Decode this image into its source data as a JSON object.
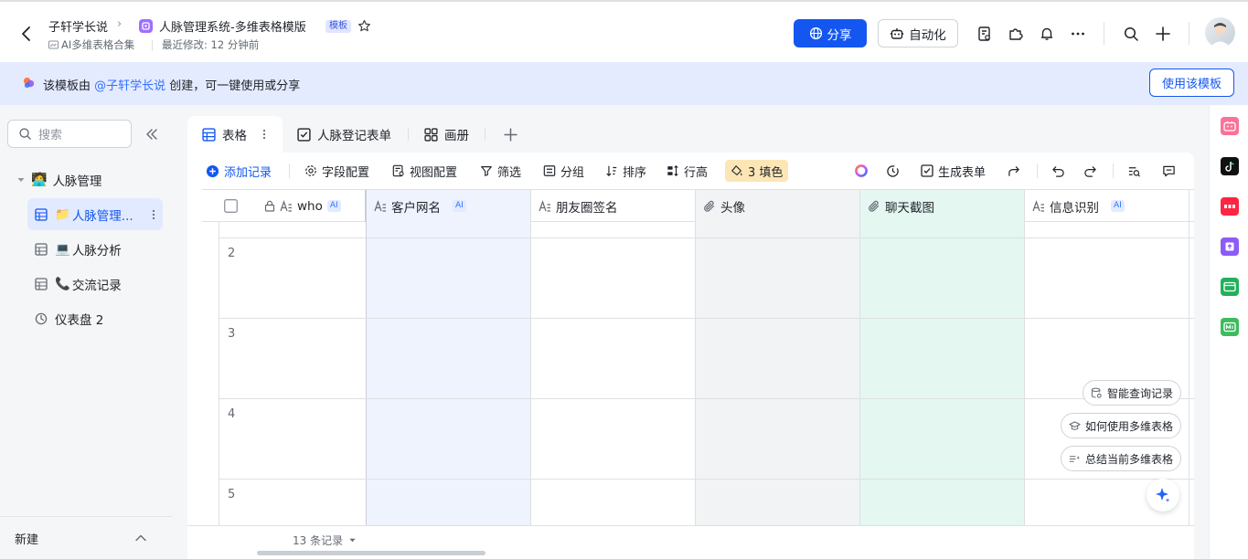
{
  "header": {
    "breadcrumb_parent": "子轩学长说",
    "doc_title": "人脉管理系统-多维表格模版",
    "template_badge": "模板",
    "folder": "AI多维表格合集",
    "last_modified": "最近修改: 12 分钟前",
    "share_label": "分享",
    "automation_label": "自动化"
  },
  "banner": {
    "prefix": "该模板由 ",
    "author": "@子轩学长说",
    "suffix": " 创建，可一键使用或分享",
    "use_template_label": "使用该模板"
  },
  "sidebar": {
    "search_placeholder": "搜索",
    "root_label": "人脉管理",
    "items": [
      {
        "label": "人脉管理...",
        "emoji": "📁"
      },
      {
        "label": "人脉分析",
        "emoji": "💻"
      },
      {
        "label": "交流记录",
        "emoji": "📞"
      },
      {
        "label": "仪表盘 2"
      }
    ],
    "new_label": "新建"
  },
  "tabs": [
    {
      "label": "表格"
    },
    {
      "label": "人脉登记表单"
    },
    {
      "label": "画册"
    }
  ],
  "toolbar": {
    "add_record": "添加记录",
    "field_config": "字段配置",
    "view_config": "视图配置",
    "filter": "筛选",
    "group": "分组",
    "sort": "排序",
    "row_height": "行高",
    "fill": "3 填色",
    "generate_form": "生成表单"
  },
  "grid": {
    "columns": [
      {
        "label": "who",
        "ai": "AI"
      },
      {
        "label": "客户网名",
        "ai": "AI"
      },
      {
        "label": "朋友圈签名"
      },
      {
        "label": "头像"
      },
      {
        "label": "聊天截图"
      },
      {
        "label": "信息识别",
        "ai": "AI"
      }
    ],
    "row_numbers": [
      "2",
      "3",
      "4",
      "5"
    ],
    "record_count": "13 条记录"
  },
  "ai_actions": [
    "智能查询记录",
    "如何使用多维表格",
    "总结当前多维表格"
  ],
  "colors": {
    "accent": "#1456f0",
    "banner_bg": "#e5ebff",
    "col_customer_bg": "#eef3fe",
    "col_avatar_bg": "#f2f3f5",
    "col_chat_bg": "#e4f7f1",
    "fill_bg": "#fde6b5"
  }
}
